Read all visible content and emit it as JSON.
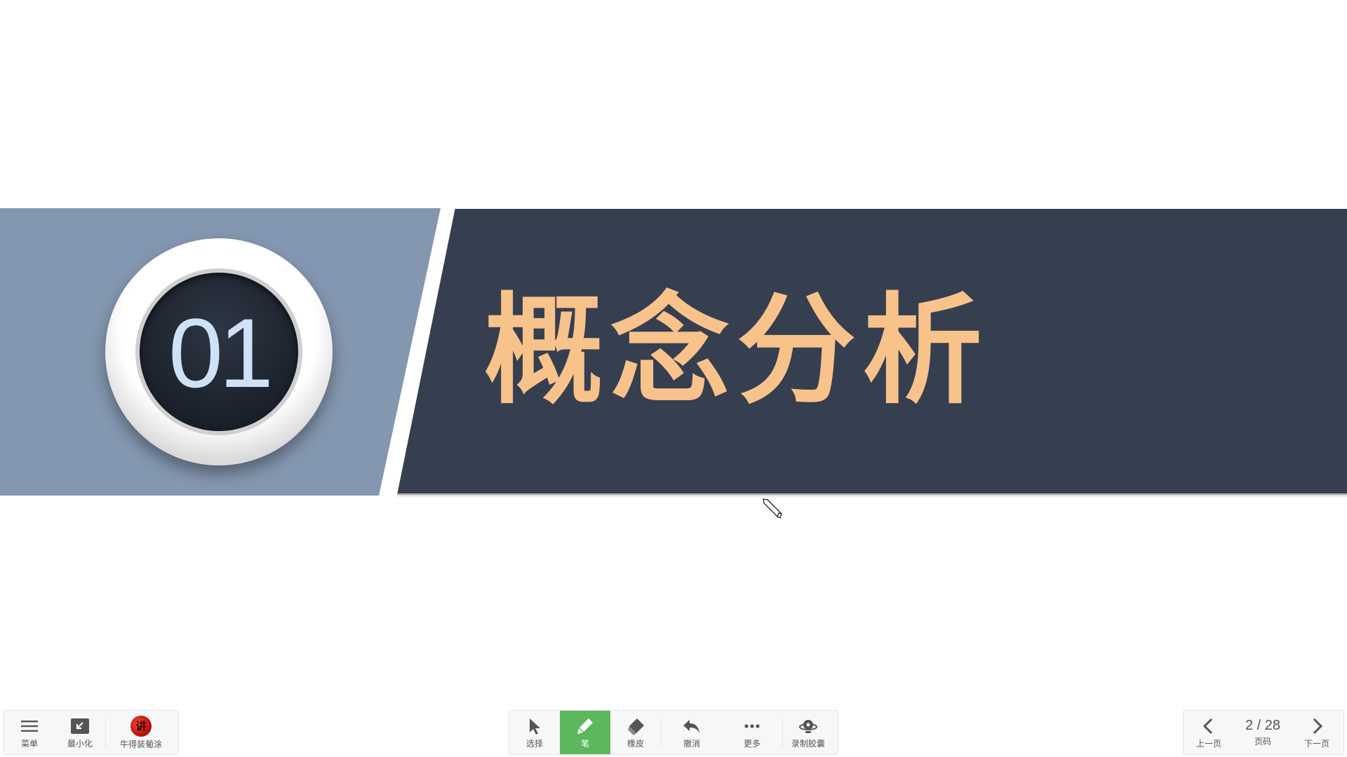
{
  "slide": {
    "section_number": "01",
    "title": "概念分析",
    "colors": {
      "left_band": "#8497b0",
      "right_band": "#353f4f",
      "title": "#f8c28b",
      "number": "#cfe1f7"
    }
  },
  "left_toolbar": {
    "menu_label": "菜单",
    "minimize_label": "最小化",
    "logo_label": "牛得装葡涂",
    "logo_text": "讲"
  },
  "center_toolbar": {
    "select_label": "选择",
    "pen_label": "笔",
    "eraser_label": "橡皮",
    "undo_label": "撤消",
    "more_label": "更多",
    "record_label": "录制胶囊",
    "active_tool": "pen",
    "active_color": "#5cb85c"
  },
  "right_toolbar": {
    "prev_label": "上一页",
    "page_display": "2 / 28",
    "page_label": "页码",
    "next_label": "下一页"
  }
}
